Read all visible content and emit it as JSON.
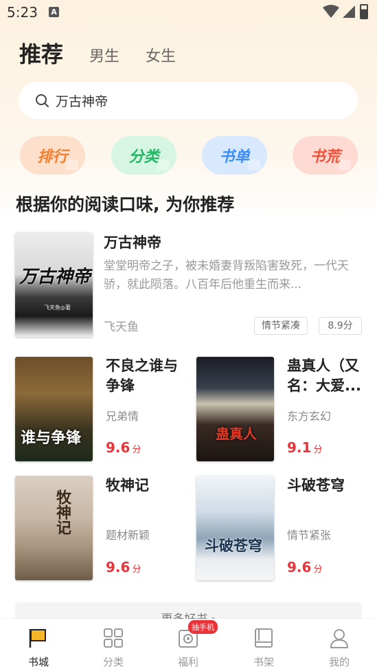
{
  "status_bar": {
    "time": "5:23",
    "notif_icon": "A"
  },
  "top_tabs": [
    {
      "label": "推荐",
      "active": true
    },
    {
      "label": "男生",
      "active": false
    },
    {
      "label": "女生",
      "active": false
    }
  ],
  "search": {
    "value": "万古神帝"
  },
  "quick_links": [
    {
      "label": "排行",
      "color": "#f57c2c"
    },
    {
      "label": "分类",
      "color": "#22b866"
    },
    {
      "label": "书单",
      "color": "#3c8df5"
    },
    {
      "label": "书荒",
      "color": "#f0533b"
    }
  ],
  "section": {
    "title": "根据你的阅读口味, 为你推荐"
  },
  "featured": {
    "cover_title": "万古神帝",
    "cover_author": "飞天鱼◎著",
    "title": "万古神帝",
    "description": "堂堂明帝之子，被未婚妻背叛陷害致死，一代天骄，就此陨落。八百年后他重生而来...",
    "author": "飞天鱼",
    "tag": "情节紧凑",
    "score": "8.9分"
  },
  "grid_books": [
    {
      "title": "不良之谁与争锋",
      "tag": "兄弟情",
      "score": "9.6",
      "unit": "分",
      "cover_title": "谁与争锋"
    },
    {
      "title": "蛊真人（又名：大爱...",
      "tag": "东方玄幻",
      "score": "9.1",
      "unit": "分",
      "cover_title": "蛊真人"
    },
    {
      "title": "牧神记",
      "tag": "题材新颖",
      "score": "9.6",
      "unit": "分",
      "cover_title": "牧神记"
    },
    {
      "title": "斗破苍穹",
      "tag": "情节紧张",
      "score": "9.6",
      "unit": "分",
      "cover_title": "斗破苍穹"
    }
  ],
  "more": {
    "label": "更多好书 ›"
  },
  "bottom_nav": [
    {
      "label": "书城",
      "icon": "flag-icon",
      "active": true
    },
    {
      "label": "分类",
      "icon": "grid-icon",
      "active": false
    },
    {
      "label": "福利",
      "icon": "gift-icon",
      "active": false,
      "badge": "抽手机"
    },
    {
      "label": "书架",
      "icon": "bookshelf-icon",
      "active": false
    },
    {
      "label": "我的",
      "icon": "user-icon",
      "active": false
    }
  ]
}
